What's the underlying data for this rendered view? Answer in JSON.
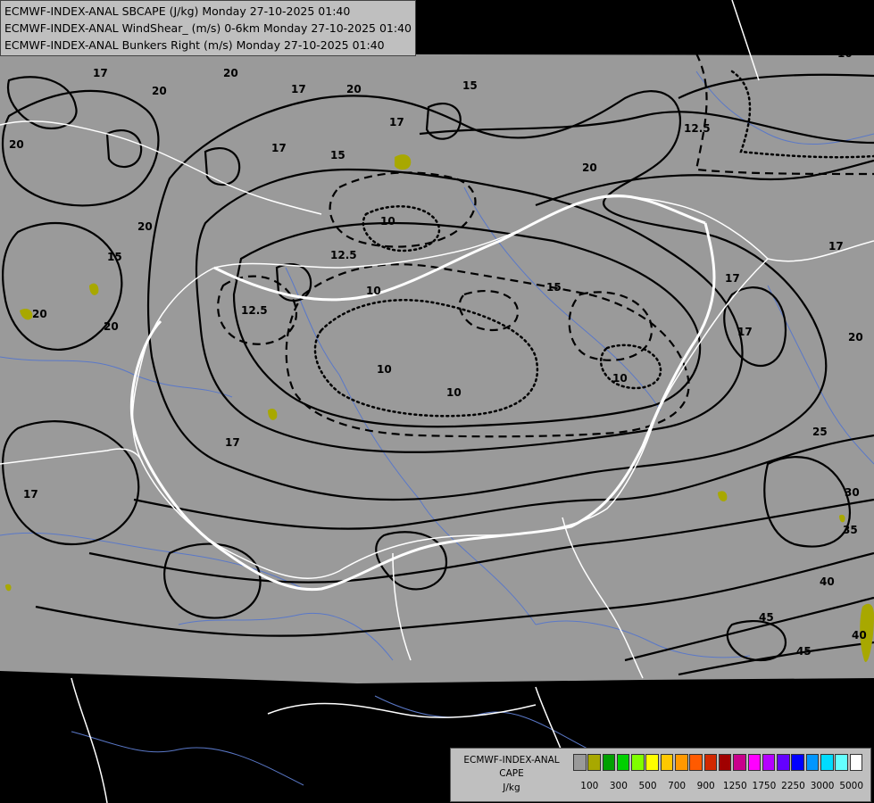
{
  "title_lines": [
    "ECMWF-INDEX-ANAL SBCAPE (J/kg) Monday 27-10-2025 01:40",
    "ECMWF-INDEX-ANAL WindShear_ (m/s) 0-6km Monday 27-10-2025 01:40",
    "ECMWF-INDEX-ANAL Bunkers Right (m/s) Monday 27-10-2025 01:40"
  ],
  "legend": {
    "line1": "ECMWF-INDEX-ANAL",
    "line2": "CAPE",
    "line3": "J/kg",
    "swatch_colors": [
      "#9a9a9a",
      "#a8a800",
      "#00a000",
      "#00d000",
      "#80ff00",
      "#ffff00",
      "#ffc800",
      "#ff9900",
      "#ff5a00",
      "#d22800",
      "#a00000",
      "#c8008c",
      "#ff00ff",
      "#b400ff",
      "#6400ff",
      "#0000ff",
      "#0096ff",
      "#00dcff",
      "#64ffff",
      "#ffffff"
    ],
    "ticks": [
      "100",
      "300",
      "500",
      "700",
      "900",
      "1250",
      "1750",
      "2250",
      "3000",
      "5000"
    ]
  },
  "contour_labels": [
    "10",
    "12.5",
    "15",
    "17",
    "20",
    "25",
    "30",
    "35",
    "40",
    "45"
  ],
  "colors": {
    "background": "#000000",
    "domain_fill": "#9a9a9a",
    "contour": "#000000",
    "border": "#ffffff",
    "river": "#5a78c8",
    "cape_100": "#a8a800"
  }
}
